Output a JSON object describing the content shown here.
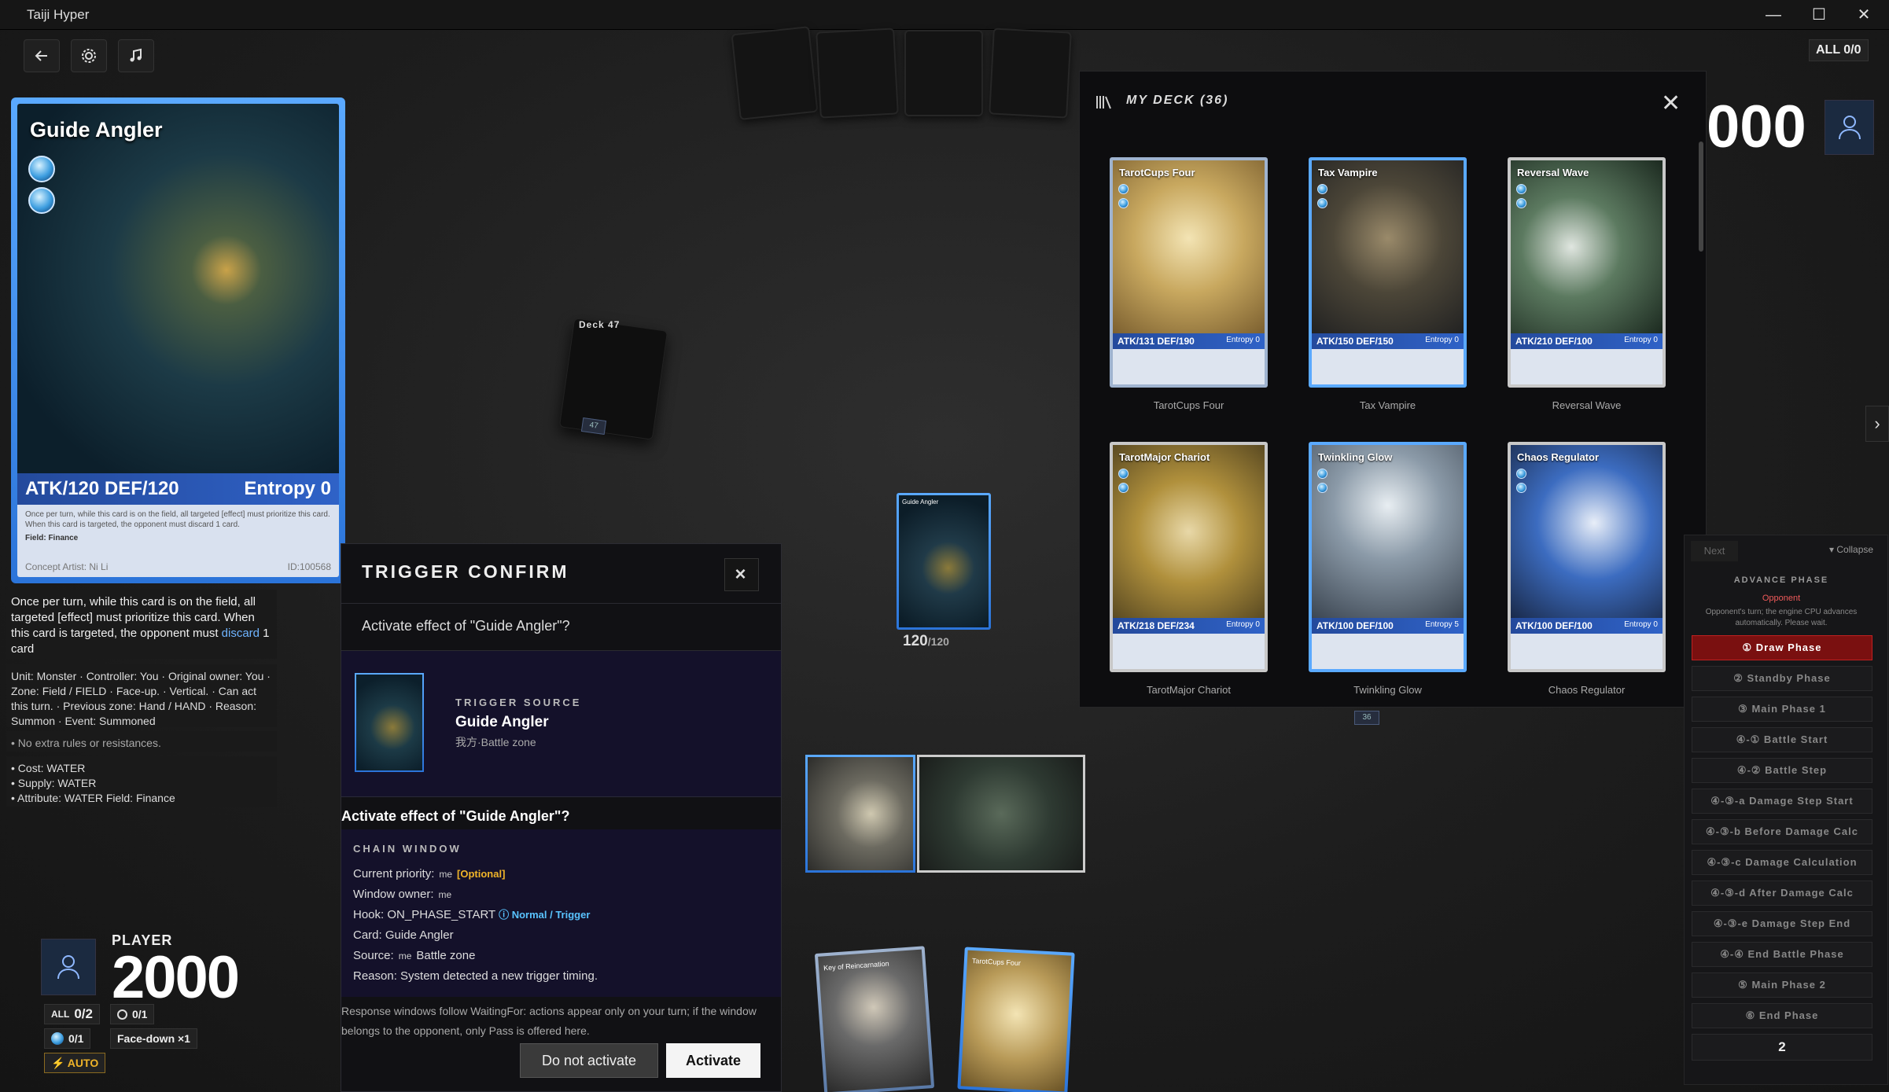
{
  "window": {
    "title": "Taiji Hyper",
    "controls": [
      "—",
      "☐",
      "✕"
    ]
  },
  "toolbar": {
    "back_icon": "arrow-left-icon",
    "settings_icon": "gear-icon",
    "music_icon": "music-note-icon"
  },
  "preview_card": {
    "name": "Guide Angler",
    "stats": "ATK/120 DEF/120",
    "entropy": "Entropy 0",
    "desc": "Once per turn, while this card is on the field, all targeted [effect] must prioritize this card. When this card is targeted, the opponent must discard 1 card.",
    "field": "Field: Finance",
    "artist": "Concept Artist: Ni Li",
    "id": "ID:100568",
    "accent": "#3d8ef0"
  },
  "details": {
    "effect_pre": "Once per turn, while this card is on the field, all targeted [effect] must prioritize this card. When this card is targeted, the opponent must ",
    "effect_link": "discard",
    "effect_post": " 1 card",
    "info": "Unit: Monster · Controller: You · Original owner: You · Zone: Field / FIELD · Face-up. · Vertical. · Can act this turn. · Previous zone: Hand / HAND · Reason: Summon · Event: Summoned",
    "rules": "• No extra rules or resistances.",
    "cost": "• Cost: WATER",
    "supply": "• Supply: WATER",
    "attribute": "• Attribute: WATER Field: Finance"
  },
  "player": {
    "label": "PLAYER",
    "score": "2000",
    "all_label": "ALL",
    "all_value": "0/2",
    "circle_count": "0/1",
    "water_count": "0/1",
    "facedown": "Face-down ×1",
    "auto": "⚡ AUTO"
  },
  "deck_pile": {
    "label": "Deck 47",
    "count": "47"
  },
  "field_card": {
    "name": "Guide Angler",
    "stats": "120",
    "stats_max": "/120"
  },
  "trigger_modal": {
    "title": "TRIGGER CONFIRM",
    "question": "Activate effect of \"Guide Angler\"?",
    "source_label": "TRIGGER SOURCE",
    "source_name": "Guide Angler",
    "source_zone": "我方·Battle zone",
    "question2": "Activate effect of \"Guide Angler\"?",
    "chain_title": "CHAIN WINDOW",
    "priority_label": "Current priority:",
    "priority_me": "me",
    "optional": "[Optional]",
    "owner_label": "Window owner:",
    "owner_me": "me",
    "hook_label": "Hook: ON_PHASE_START",
    "hook_type": "ⓘ Normal / Trigger",
    "card_line": "Card: Guide Angler",
    "source_line_label": "Source:",
    "source_me": "me",
    "source_zone_line": "Battle zone",
    "reason": "Reason: System detected a new trigger timing.",
    "note": "Response windows follow WaitingFor: actions appear only on your turn; if the window belongs to the opponent, only Pass is offered here.",
    "decline": "Do not activate",
    "activate": "Activate"
  },
  "deck_drawer": {
    "title": "MY DECK (36)",
    "cards": [
      {
        "name": "TarotCups Four",
        "atk": "ATK/131 DEF/190",
        "entropy": "Entropy 0",
        "frame": "#9fb3cf"
      },
      {
        "name": "Tax Vampire",
        "atk": "ATK/150 DEF/150",
        "entropy": "Entropy 0",
        "frame": "#5aa9ff"
      },
      {
        "name": "Reversal Wave",
        "atk": "ATK/210 DEF/100",
        "entropy": "Entropy 0",
        "frame": "#c8c8c8"
      },
      {
        "name": "TarotMajor Chariot",
        "atk": "ATK/218 DEF/234",
        "entropy": "Entropy 0",
        "frame": "#c8c8c8"
      },
      {
        "name": "Twinkling Glow",
        "atk": "ATK/100 DEF/100",
        "entropy": "Entropy 5",
        "frame": "#5aa9ff"
      },
      {
        "name": "Chaos Regulator",
        "atk": "ATK/100 DEF/100",
        "entropy": "Entropy 0",
        "frame": "#c8c8c8"
      }
    ]
  },
  "opponent": {
    "score": "000",
    "all": "ALL 0/0"
  },
  "phase_panel": {
    "next": "Next",
    "collapse": "▾ Collapse",
    "title": "ADVANCE PHASE",
    "whose": "Opponent",
    "note": "Opponent's turn; the engine CPU advances automatically. Please wait.",
    "phases": [
      "① Draw Phase",
      "② Standby Phase",
      "③ Main Phase 1",
      "④-① Battle Start",
      "④-② Battle Step",
      "④-③-a Damage Step Start",
      "④-③-b Before Damage Calc",
      "④-③-c Damage Calculation",
      "④-③-d After Damage Calc",
      "④-③-e Damage Step End",
      "④-④ End Battle Phase",
      "⑤ Main Phase 2",
      "⑥ End Phase"
    ],
    "count": "2"
  },
  "hand": [
    {
      "name": "Key of Reincarnation"
    },
    {
      "name": "TarotCups Four"
    }
  ],
  "misc": {
    "badge_36": "36"
  }
}
